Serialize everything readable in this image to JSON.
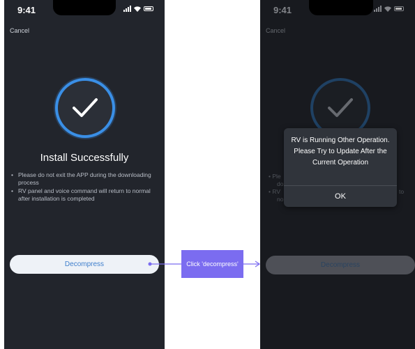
{
  "left_screen": {
    "time": "9:41",
    "cancel_label": "Cancel",
    "title": "Install Successfully",
    "bullets": [
      "Please do not exit the APP during the downloading process",
      "RV panel and voice command will return to normal after installation is completed"
    ],
    "primary_button": "Decompress"
  },
  "annotation": {
    "label": "Click 'decompress'"
  },
  "right_screen": {
    "time": "9:41",
    "cancel_label": "Cancel",
    "bullet_fragments": [
      "Ple",
      "do",
      "RV",
      "no",
      "to"
    ],
    "disabled_button": "Decompress",
    "dialog": {
      "message": "RV is Running Other Operation. Please Try to Update After the Current Operation",
      "ok_label": "OK"
    }
  },
  "colors": {
    "phone_bg": "#22252c",
    "accent_ring": "#3a8fe6",
    "annotation": "#7b6cf0",
    "button_text": "#3f7fcc"
  },
  "icons": [
    "signal-icon",
    "wifi-icon",
    "battery-icon",
    "checkmark-icon",
    "arrow-right-icon"
  ]
}
